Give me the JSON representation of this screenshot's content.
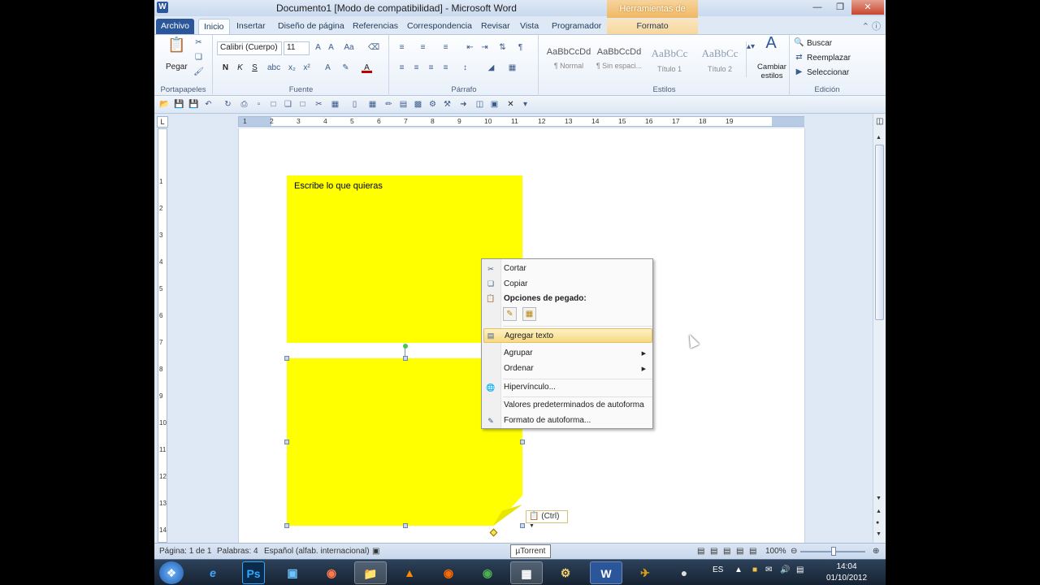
{
  "window": {
    "title": "Documento1 [Modo de compatibilidad] - Microsoft Word",
    "contextual_tab_group": "Herramientas de dibujo"
  },
  "tabs": [
    "Archivo",
    "Inicio",
    "Insertar",
    "Diseño de página",
    "Referencias",
    "Correspondencia",
    "Revisar",
    "Vista",
    "Programador",
    "Formato"
  ],
  "ribbon": {
    "paste_label": "Pegar",
    "font_name": "Calibri (Cuerpo)",
    "font_size": "11",
    "bold": "N",
    "italic": "K",
    "underline": "S",
    "styles": [
      {
        "sample": "AaBbCcDd",
        "name": "¶ Normal"
      },
      {
        "sample": "AaBbCcDd",
        "name": "¶ Sin espaci..."
      },
      {
        "sample": "AaBbCc",
        "name": "Título 1"
      },
      {
        "sample": "AaBbCc",
        "name": "Título 2"
      }
    ],
    "change_styles": "Cambiar estilos",
    "find": "Buscar",
    "replace": "Reemplazar",
    "select": "Seleccionar",
    "groups": {
      "clipboard": "Portapapeles",
      "font": "Fuente",
      "paragraph": "Párrafo",
      "styles": "Estilos",
      "editing": "Edición"
    }
  },
  "document": {
    "shape1_text": "Escribe lo que quieras",
    "paste_tag": "(Ctrl)"
  },
  "context_menu": {
    "items": {
      "cut": "Cortar",
      "copy": "Copiar",
      "paste_options": "Opciones de pegado:",
      "add_text": "Agregar texto",
      "group": "Agrupar",
      "order": "Ordenar",
      "hyperlink": "Hipervínculo...",
      "defaults": "Valores predeterminados de autoforma",
      "format": "Formato de autoforma..."
    }
  },
  "ruler_numbers": [
    "1",
    "2",
    "3",
    "4",
    "5",
    "6",
    "7",
    "8",
    "9",
    "10",
    "11",
    "12",
    "13",
    "14",
    "15",
    "16",
    "17",
    "18",
    "19"
  ],
  "vruler_numbers": [
    "1",
    "2",
    "3",
    "4",
    "5",
    "6",
    "7",
    "8",
    "9",
    "10",
    "11",
    "12",
    "13",
    "14"
  ],
  "status": {
    "page": "Página: 1 de 1",
    "words": "Palabras: 4",
    "language": "Español (alfab. internacional)",
    "tooltip": "µTorrent",
    "zoom": "100%"
  },
  "taskbar": {
    "language": "ES",
    "time": "14:04",
    "date": "01/10/2012",
    "apps": [
      "e",
      "Ps",
      "",
      "",
      "",
      "",
      "",
      "",
      "",
      "",
      "W",
      "",
      ""
    ]
  },
  "colors": {
    "shape_fill": "#ffff00",
    "file_tab": "#2b579a",
    "highlight": "#f7d983"
  }
}
